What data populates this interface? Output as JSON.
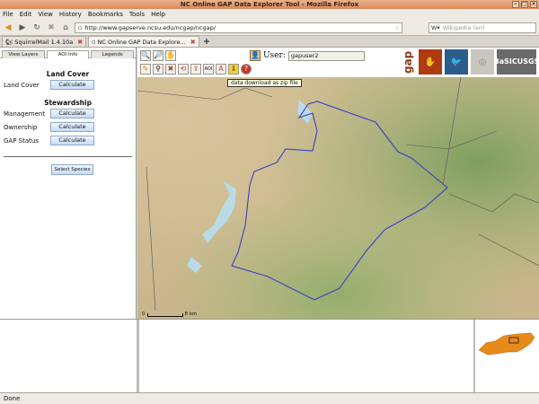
{
  "window": {
    "title": "NC Online GAP Data Explorer Tool - Mozilla Firefox"
  },
  "menu": [
    "File",
    "Edit",
    "View",
    "History",
    "Bookmarks",
    "Tools",
    "Help"
  ],
  "nav": {
    "url": "http://www.gapserve.ncsu.edu/ncgap/ncgap/",
    "search_placeholder": "Wikipedia (en)"
  },
  "tabs": [
    {
      "label": "SquirrelMail 1.4.10a"
    },
    {
      "label": "NC Online GAP Data Explore..."
    }
  ],
  "sidebar": {
    "tabs": [
      "View Layers",
      "AOI Info",
      "Legends"
    ],
    "land_cover": {
      "heading": "Land Cover",
      "label": "Land Cover",
      "button": "Calculate"
    },
    "stewardship": {
      "heading": "Stewardship",
      "rows": [
        {
          "label": "Management",
          "button": "Calculate"
        },
        {
          "label": "Ownership",
          "button": "Calculate"
        },
        {
          "label": "GAP Status",
          "button": "Calculate"
        }
      ]
    },
    "select_species": "Select Species"
  },
  "map_toolbar": {
    "user_label": "User:",
    "user_value": "gapuser2",
    "tooltip": "data download as zip file"
  },
  "logos": {
    "gap": "gap",
    "basic": "BaSIC",
    "usgs": "USGS"
  },
  "scale": {
    "start": "0",
    "end": "8 km"
  },
  "status": "Done",
  "colors": {
    "aoi_outline": "#3a3fc9",
    "water": "#b8dbe8",
    "map_green": "#8fa86a",
    "map_tan": "#d6c196",
    "nc_state": "#e88a1a"
  }
}
